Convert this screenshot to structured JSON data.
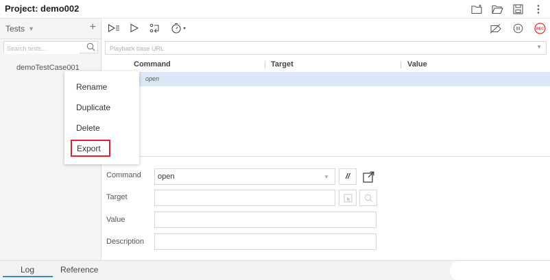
{
  "header": {
    "project_label": "Project: demo002",
    "icons": [
      "new-folder-icon",
      "open-folder-icon",
      "save-icon",
      "more-vertical-icon"
    ]
  },
  "sidebar": {
    "tests_label": "Tests",
    "search_placeholder": "Search tests...",
    "test_items": [
      {
        "label": "demoTestCase001"
      }
    ]
  },
  "context_menu": {
    "items": [
      "Rename",
      "Duplicate",
      "Delete",
      "Export"
    ],
    "highlighted": "Export",
    "highlight_color": "#e0202a"
  },
  "toolbar": {
    "left_icons": [
      "run-all-icon",
      "run-icon",
      "step-icon",
      "speed-icon"
    ],
    "right_icons": [
      "disable-breakpoints-icon",
      "pause-icon",
      "record-icon"
    ],
    "record_label": "REC",
    "url_placeholder": "Playback base URL"
  },
  "table": {
    "headers": [
      "Command",
      "Target",
      "Value"
    ],
    "rows": [
      {
        "command": "open",
        "target": "",
        "value": ""
      }
    ],
    "selected_bg": "#dbe8f7"
  },
  "editor": {
    "command_label": "Command",
    "command_value": "open",
    "comment_toggle": "//",
    "target_label": "Target",
    "target_value": "",
    "value_label": "Value",
    "value_value": "",
    "description_label": "Description",
    "description_value": ""
  },
  "bottom_tabs": {
    "log": "Log",
    "reference": "Reference",
    "active": "Log"
  }
}
